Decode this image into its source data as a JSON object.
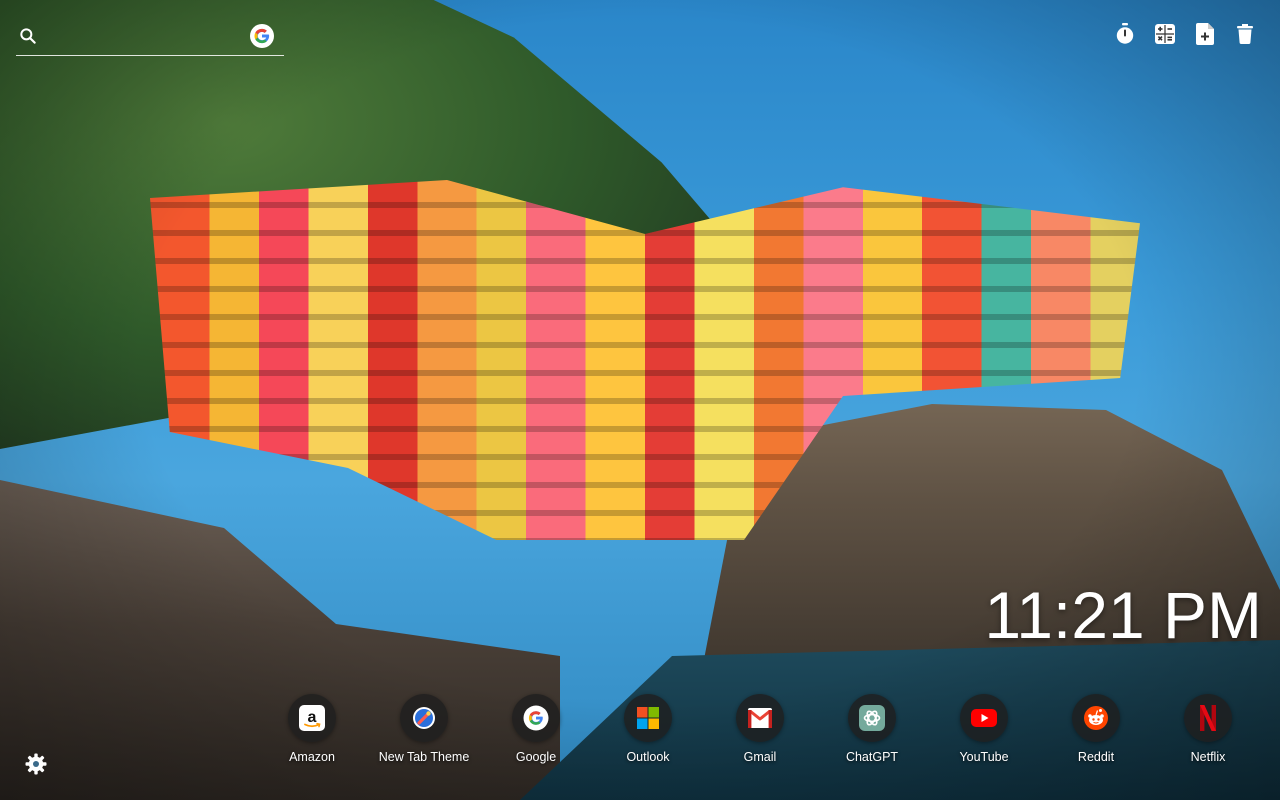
{
  "search": {
    "placeholder": "",
    "engine_icon": "google-g-icon"
  },
  "toolbar": {
    "items": [
      {
        "icon": "timer-icon",
        "label": "Timer"
      },
      {
        "icon": "calculator-icon",
        "label": "Calculator"
      },
      {
        "icon": "add-note-icon",
        "label": "New note"
      },
      {
        "icon": "trash-icon",
        "label": "Delete"
      }
    ]
  },
  "clock": {
    "time": "11:21 PM"
  },
  "shortcuts": [
    {
      "label": "Amazon",
      "icon": "amazon-icon"
    },
    {
      "label": "New Tab Theme",
      "icon": "new-tab-theme-icon"
    },
    {
      "label": "Google",
      "icon": "google-icon"
    },
    {
      "label": "Outlook",
      "icon": "outlook-icon"
    },
    {
      "label": "Gmail",
      "icon": "gmail-icon"
    },
    {
      "label": "ChatGPT",
      "icon": "chatgpt-icon"
    },
    {
      "label": "YouTube",
      "icon": "youtube-icon"
    },
    {
      "label": "Reddit",
      "icon": "reddit-icon"
    },
    {
      "label": "Netflix",
      "icon": "netflix-icon"
    }
  ],
  "settings": {
    "icon": "gear-icon"
  },
  "colors": {
    "google_blue": "#4285F4",
    "google_red": "#EA4335",
    "google_yellow": "#FBBC05",
    "google_green": "#34A853",
    "youtube_red": "#FF0000",
    "reddit_orange": "#FF4500",
    "netflix_red": "#E50914",
    "chatgpt_teal": "#74AA9C"
  }
}
